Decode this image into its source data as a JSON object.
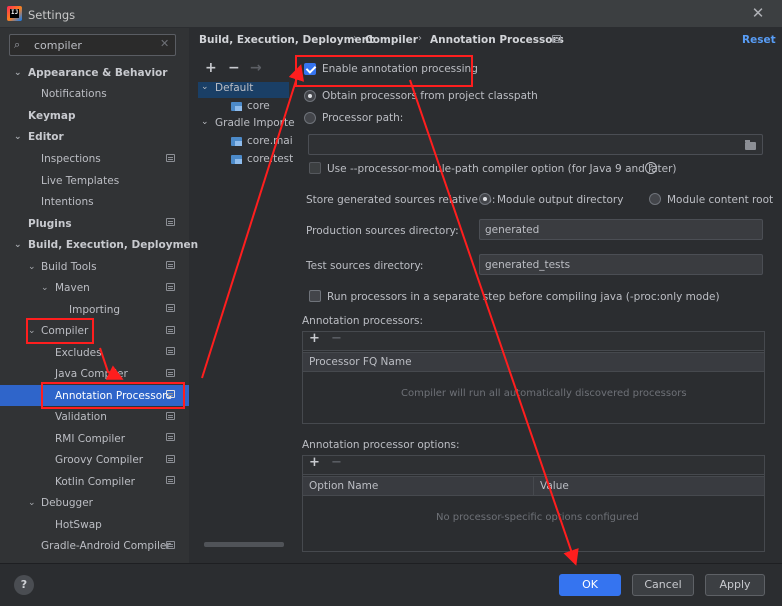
{
  "window": {
    "title": "Settings"
  },
  "search": {
    "value": "compiler"
  },
  "nav": {
    "items": [
      {
        "label": "Appearance & Behavior"
      },
      {
        "label": "Notifications"
      },
      {
        "label": "Keymap"
      },
      {
        "label": "Editor"
      },
      {
        "label": "Inspections"
      },
      {
        "label": "Live Templates"
      },
      {
        "label": "Intentions"
      },
      {
        "label": "Plugins"
      },
      {
        "label": "Build, Execution, Deployment"
      },
      {
        "label": "Build Tools"
      },
      {
        "label": "Maven"
      },
      {
        "label": "Importing"
      },
      {
        "label": "Compiler"
      },
      {
        "label": "Excludes"
      },
      {
        "label": "Java Compiler"
      },
      {
        "label": "Annotation Processors"
      },
      {
        "label": "Validation"
      },
      {
        "label": "RMI Compiler"
      },
      {
        "label": "Groovy Compiler"
      },
      {
        "label": "Kotlin Compiler"
      },
      {
        "label": "Debugger"
      },
      {
        "label": "HotSwap"
      },
      {
        "label": "Gradle-Android Compiler"
      }
    ]
  },
  "modules": {
    "items": [
      {
        "label": "Default"
      },
      {
        "label": "core"
      },
      {
        "label": "Gradle Importe"
      },
      {
        "label": "core.mai"
      },
      {
        "label": "core.test"
      }
    ]
  },
  "breadcrumb": {
    "items": [
      "Build, Execution, Deployment",
      "Compiler",
      "Annotation Processors"
    ],
    "separator": "›"
  },
  "reset_label": "Reset",
  "form": {
    "enable_label": "Enable annotation processing",
    "obtain_label": "Obtain processors from project classpath",
    "processor_path_label": "Processor path:",
    "processor_path_value": "",
    "module_path_label": "Use --processor-module-path compiler option (for Java 9 and later)",
    "store_label": "Store generated sources relative to:",
    "module_output_label": "Module output directory",
    "module_content_label": "Module content root",
    "production_label": "Production sources directory:",
    "production_value": "generated",
    "test_label": "Test sources directory:",
    "test_value": "generated_tests",
    "separate_step_label": "Run processors in a separate step before compiling java (-proc:only mode)",
    "processors_label": "Annotation processors:",
    "processors_header": "Processor FQ Name",
    "processors_empty": "Compiler will run all automatically discovered processors",
    "options_label": "Annotation processor options:",
    "options_header_name": "Option Name",
    "options_header_value": "Value",
    "options_empty": "No processor-specific options configured"
  },
  "toolbar": {
    "add": "+",
    "remove": "−",
    "move": "→"
  },
  "footer": {
    "help": "?",
    "ok": "OK",
    "cancel": "Cancel",
    "apply": "Apply"
  },
  "colors": {
    "accent": "#3574f0",
    "annotation": "#ff1e1e",
    "link": "#589df6"
  }
}
